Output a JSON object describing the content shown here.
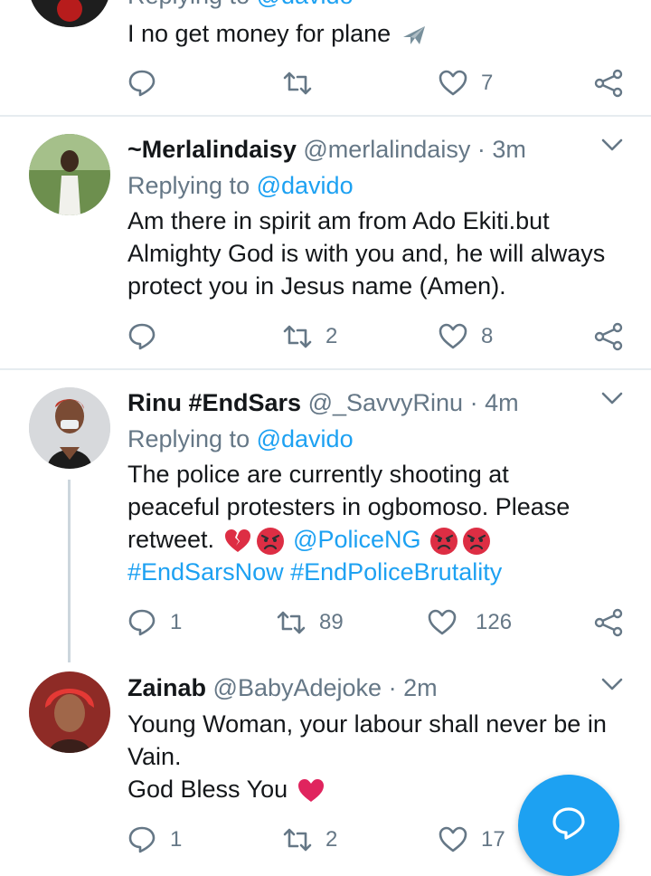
{
  "tweets": [
    {
      "reply_prefix": "Replying to",
      "reply_mention": "@davido",
      "lines": [
        "I no get money for plane"
      ],
      "emoji_plane": "airplane-emoji",
      "reply_count": "",
      "retweet_count": "",
      "like_count": "7"
    },
    {
      "name": "~Merlalindaisy",
      "handle": "@merlalindaisy",
      "dot": "·",
      "time": "3m",
      "reply_prefix": "Replying to",
      "reply_mention": "@davido",
      "lines": [
        "Am there in spirit am from Ado Ekiti.but",
        "Almighty God is with you and, he will always",
        "protect you in Jesus name (Amen)."
      ],
      "reply_count": "",
      "retweet_count": "2",
      "like_count": "8"
    },
    {
      "name": "Rinu #EndSars",
      "handle": "@_SavvyRinu",
      "dot": "·",
      "time": "4m",
      "reply_prefix": "Replying to",
      "reply_mention": "@davido",
      "lines": [
        "The police are currently shooting at",
        "peaceful protesters in ogbomoso. Please"
      ],
      "line3_text": "retweet.",
      "line3_mention": "@PoliceNG",
      "hashtags": "#EndSarsNow #EndPoliceBrutality",
      "reply_count": "1",
      "retweet_count": "89",
      "like_count": "126"
    },
    {
      "name": "Zainab",
      "handle": "@BabyAdejoke",
      "dot": "·",
      "time": "2m",
      "lines": [
        "Young Woman, your labour shall never be in",
        "Vain.",
        "God Bless You"
      ],
      "reply_count": "1",
      "retweet_count": "2",
      "like_count": "17"
    }
  ],
  "colors": {
    "accent": "#1da1f2",
    "secondary_text": "#657786",
    "separator": "#e6ecf0",
    "heart_emoji": "#e0245e",
    "angry_emoji": "#dd2e44"
  },
  "icons": [
    "reply-icon",
    "retweet-icon",
    "like-icon",
    "share-icon",
    "chevron-down-icon",
    "compose-icon"
  ]
}
